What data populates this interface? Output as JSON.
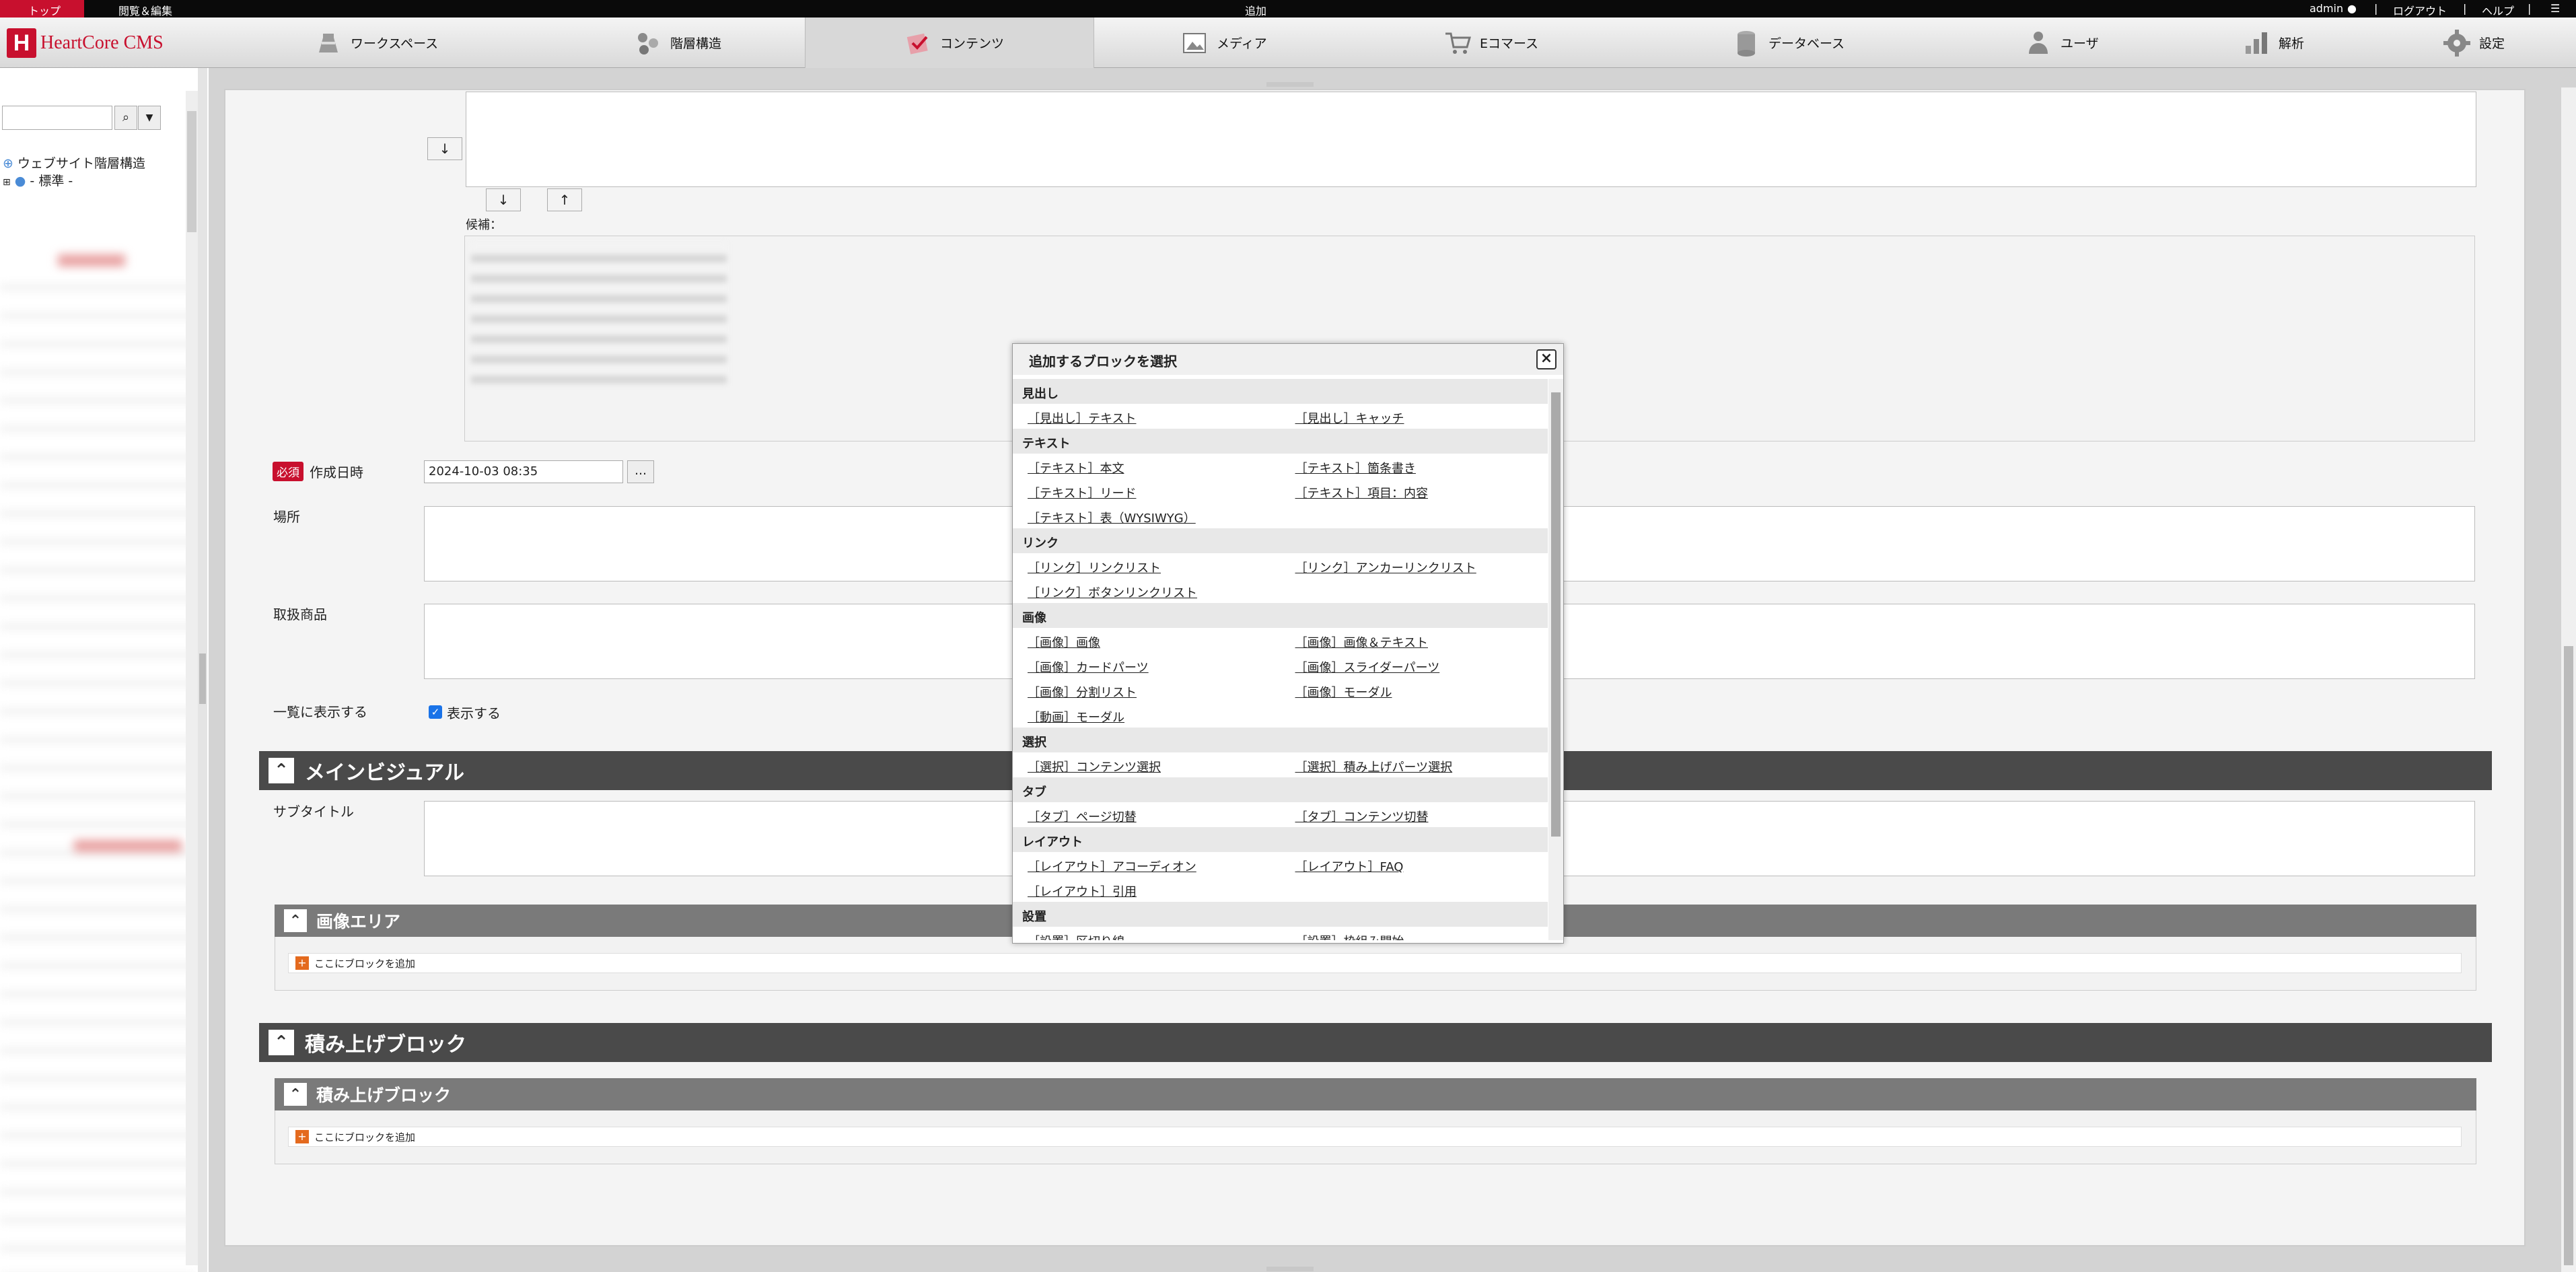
{
  "topbar": {
    "top_label": "トップ",
    "view_edit": "閲覧＆編集",
    "center": "追加",
    "user": "admin",
    "logout": "ログアウト",
    "help": "ヘルプ",
    "sep": "|",
    "menu_icon": "menu-icon"
  },
  "logo": {
    "mark": "H",
    "text": "HeartCore CMS"
  },
  "nav": [
    {
      "label": "ワークスペース",
      "icon": "workspace-icon"
    },
    {
      "label": "階層構造",
      "icon": "hierarchy-icon"
    },
    {
      "label": "コンテンツ",
      "icon": "content-icon"
    },
    {
      "label": "メディア",
      "icon": "media-icon"
    },
    {
      "label": "Eコマース",
      "icon": "cart-icon"
    },
    {
      "label": "データベース",
      "icon": "database-icon"
    },
    {
      "label": "ユーザ",
      "icon": "users-icon"
    },
    {
      "label": "解析",
      "icon": "analytics-icon"
    },
    {
      "label": "設定",
      "icon": "gear-icon"
    }
  ],
  "tree": {
    "root": "ウェブサイト階層構造",
    "child": "- 標準 -"
  },
  "form": {
    "down_arrow": "↓",
    "up_arrow": "↑",
    "candidates_label": "候補：",
    "required_badge": "必須",
    "created_label": "作成日時",
    "created_value": "2024-10-03 08:35",
    "date_btn": "...",
    "place_label": "場所",
    "products_label": "取扱商品",
    "list_label": "一覧に表示する",
    "list_check_label": "表示する"
  },
  "sections": {
    "main_visual": "メインビジュアル",
    "subtitle_label": "サブタイトル",
    "image_area": "画像エリア",
    "add_block": "ここにブロックを追加",
    "stack_block": "積み上げブロック",
    "stack_sub": "積み上げブロック"
  },
  "modal": {
    "title": "追加するブロックを選択",
    "close": "×",
    "categories": [
      {
        "name": "見出し",
        "items": [
          "［見出し］テキスト",
          "［見出し］キャッチ"
        ]
      },
      {
        "name": "テキスト",
        "items": [
          "［テキスト］本文",
          "［テキスト］箇条書き",
          "［テキスト］リード",
          "［テキスト］項目：内容",
          "［テキスト］表（WYSIWYG）"
        ]
      },
      {
        "name": "リンク",
        "items": [
          "［リンク］リンクリスト",
          "［リンク］アンカーリンクリスト",
          "［リンク］ボタンリンクリスト"
        ]
      },
      {
        "name": "画像",
        "items": [
          "［画像］画像",
          "［画像］画像＆テキスト",
          "［画像］カードパーツ",
          "［画像］スライダーパーツ",
          "［画像］分割リスト",
          "［画像］モーダル",
          "［動画］モーダル"
        ]
      },
      {
        "name": "選択",
        "items": [
          "［選択］コンテンツ選択",
          "［選択］積み上げパーツ選択"
        ]
      },
      {
        "name": "タブ",
        "items": [
          "［タブ］ページ切替",
          "［タブ］コンテンツ切替"
        ]
      },
      {
        "name": "レイアウト",
        "items": [
          "［レイアウト］アコーディオン",
          "［レイアウト］FAQ",
          "［レイアウト］引用"
        ]
      },
      {
        "name": "設置",
        "items": [
          "［設置］区切り線",
          "［設置］枠組み開始"
        ]
      }
    ]
  }
}
